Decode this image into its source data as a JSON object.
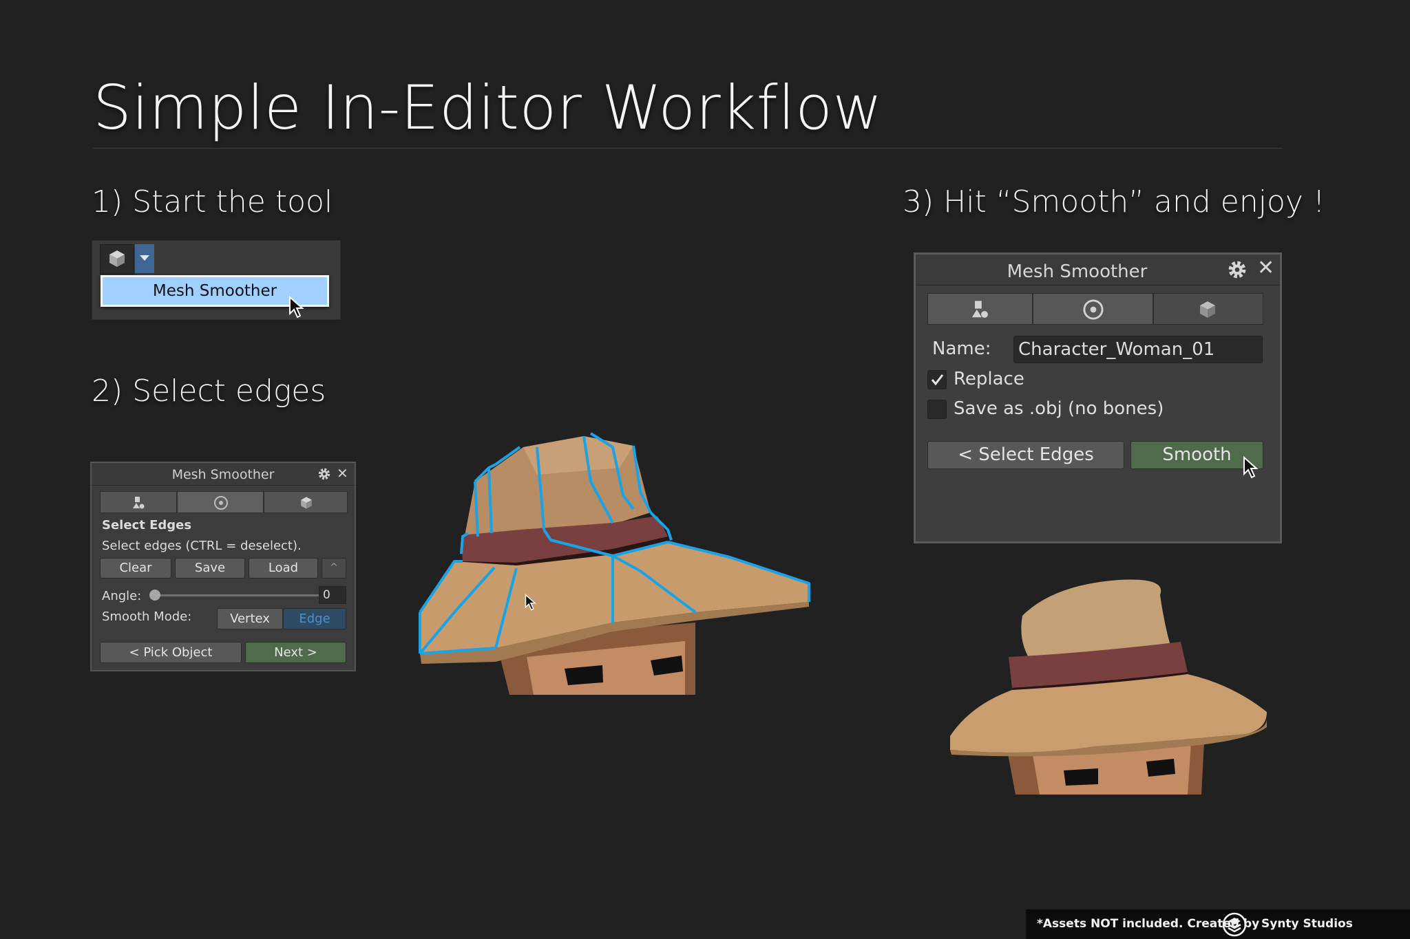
{
  "page": {
    "title": "Simple In-Editor Workflow",
    "step1": "1) Start the tool",
    "step2": "2) Select edges",
    "step3": "3) Hit  “Smooth” and enjoy !"
  },
  "tool_menu": {
    "toolbar_icon": "cube-icon",
    "dropdown_icon": "caret-down-icon",
    "item": "Mesh Smoother"
  },
  "panel_small": {
    "title": "Mesh Smoother",
    "tabs": [
      "shapes-icon",
      "target-icon",
      "cube-icon"
    ],
    "section": "Select Edges",
    "hint": "Select edges (CTRL = deselect).",
    "buttons": {
      "clear": "Clear",
      "save": "Save",
      "load": "Load",
      "collapse": "^"
    },
    "angle_label": "Angle:",
    "angle_value": "0",
    "smooth_mode_label": "Smooth Mode:",
    "modes": [
      "Vertex",
      "Edge"
    ],
    "selected_mode": "Edge",
    "back": "< Pick Object",
    "next": "Next >"
  },
  "panel_large": {
    "title": "Mesh Smoother",
    "tabs": [
      "shapes-icon",
      "target-icon",
      "cube-icon"
    ],
    "name_label": "Name:",
    "name_value": "Character_Woman_01",
    "replace_label": "Replace",
    "replace_checked": true,
    "save_obj_label": "Save as .obj (no bones)",
    "save_obj_checked": false,
    "back": "< Select Edges",
    "smooth": "Smooth"
  },
  "footer": {
    "text": "*Assets NOT included. Created by",
    "brand": "Synty Studios"
  },
  "colors": {
    "background": "#212121",
    "edge_highlight": "#1aa3e6",
    "menu_highlight": "#9fd0ff",
    "green_button": "#4f6b4b",
    "hat": "#c49b6e",
    "hat_band": "#7a4040"
  }
}
